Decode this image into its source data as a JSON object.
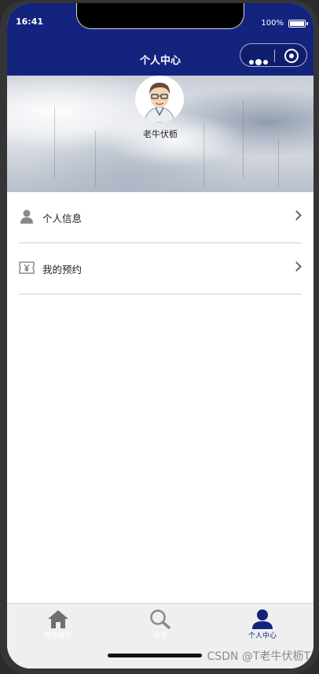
{
  "status_bar": {
    "time": "16:41",
    "battery": "100%"
  },
  "nav": {
    "title": "个人中心"
  },
  "profile": {
    "username": "老牛伏枥"
  },
  "menu": [
    {
      "label": "个人信息",
      "icon": "user-icon"
    },
    {
      "label": "我的预约",
      "icon": "ticket-yen-icon"
    }
  ],
  "tabs": [
    {
      "label": "宠物首页",
      "icon": "home-icon",
      "active": false
    },
    {
      "label": "搜索",
      "icon": "search-icon",
      "active": false
    },
    {
      "label": "个人中心",
      "icon": "user-icon",
      "active": true
    }
  ],
  "watermark": "CSDN @T老牛伏枥T",
  "colors": {
    "brand": "#13237e",
    "tab_inactive": "#777777",
    "tab_active": "#13237e"
  }
}
